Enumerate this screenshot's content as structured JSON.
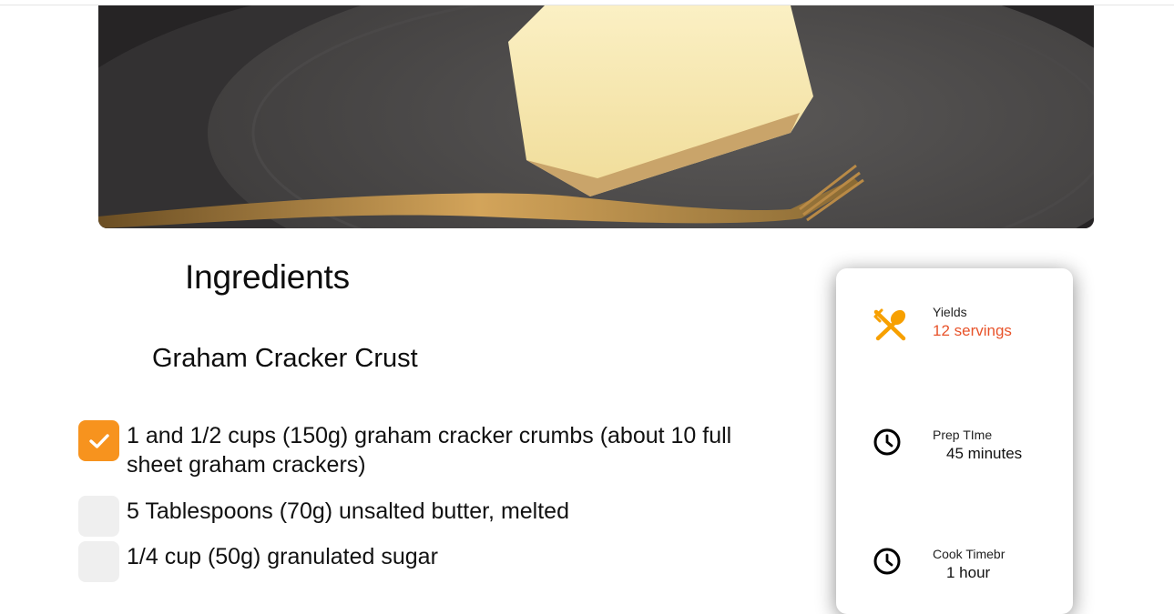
{
  "hero_image": {
    "alt": "slice of cheesecake on a plate with a fork"
  },
  "ingredients": {
    "title": "Ingredients",
    "section_title": "Graham Cracker Crust",
    "items": [
      {
        "text": "1 and 1/2 cups (150g) graham cracker crumbs (about 10 full sheet graham crackers)",
        "checked": true
      },
      {
        "text": "5 Tablespoons (70g) unsalted butter, melted",
        "checked": false
      },
      {
        "text": "1/4 cup (50g) granulated sugar",
        "checked": false
      }
    ]
  },
  "info_card": {
    "yields": {
      "label": "Yields",
      "value": "12 servings",
      "icon": "utensils-icon"
    },
    "prep": {
      "label": "Prep TIme",
      "value": "45 minutes",
      "icon": "clock-icon"
    },
    "cook": {
      "label": "Cook Timebr",
      "value": "1 hour",
      "icon": "clock-icon"
    }
  },
  "colors": {
    "accent_orange": "#f7931e",
    "yields_value": "#e8532a",
    "checkbox_unchecked": "#efefef"
  }
}
